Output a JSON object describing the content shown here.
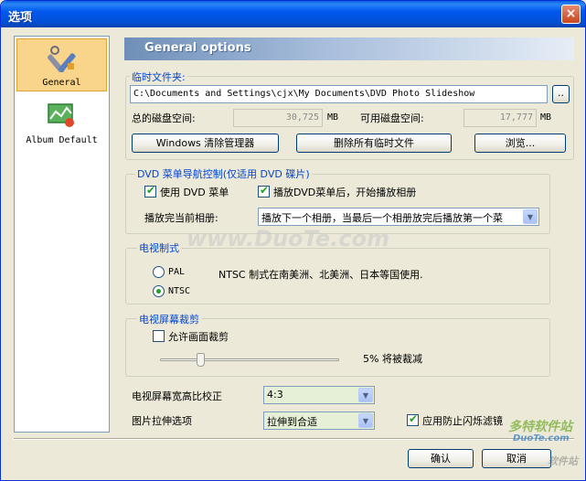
{
  "window": {
    "title": "选项",
    "close_label": "×"
  },
  "nav": [
    {
      "label": "General",
      "icon": "tools-icon"
    },
    {
      "label": "Album Default",
      "icon": "album-icon"
    }
  ],
  "header": {
    "title": "General options"
  },
  "temp": {
    "group_title": "临时文件夹:",
    "path": "C:\\Documents and Settings\\cjx\\My Documents\\DVD Photo Slideshow",
    "browse_small": "..",
    "total_label": "总的磁盘空间:",
    "total_value": "30,725",
    "total_unit": "MB",
    "free_label": "可用磁盘空间:",
    "free_value": "17,777",
    "free_unit": "MB",
    "btn_cleanup": "Windows 清除管理器",
    "btn_delete": "删除所有临时文件",
    "btn_browse": "浏览..."
  },
  "dvd": {
    "group_title": "DVD 菜单导航控制(仅适用 DVD 碟片)",
    "use_menu": "使用 DVD 菜单",
    "play_after_menu": "播放DVD菜单后，开始播放相册",
    "after_label": "播放完当前相册:",
    "after_value": "播放下一个相册，当最后一个相册放完后播放第一个菜"
  },
  "tv": {
    "group_title": "电视制式",
    "pal": "PAL",
    "ntsc": "NTSC",
    "note": "NTSC 制式在南美洲、北美洲、日本等国使用."
  },
  "crop": {
    "group_title": "电视屏幕裁剪",
    "allow": "允许画面裁剪",
    "percent_text": "5% 将被裁减",
    "slider_value": 0.25
  },
  "aspect": {
    "label": "电视屏幕宽高比校正",
    "value": "4:3"
  },
  "stretch": {
    "label": "图片拉伸选项",
    "value": "拉伸到合适",
    "flicker": "应用防止闪烁滤镜"
  },
  "footer": {
    "ok": "确认",
    "cancel": "取消"
  },
  "watermarks": {
    "center": "www.DuoTe.com",
    "corner": "多特软件站",
    "corner_url": "DuoTe.com",
    "corner2": "软件站"
  }
}
